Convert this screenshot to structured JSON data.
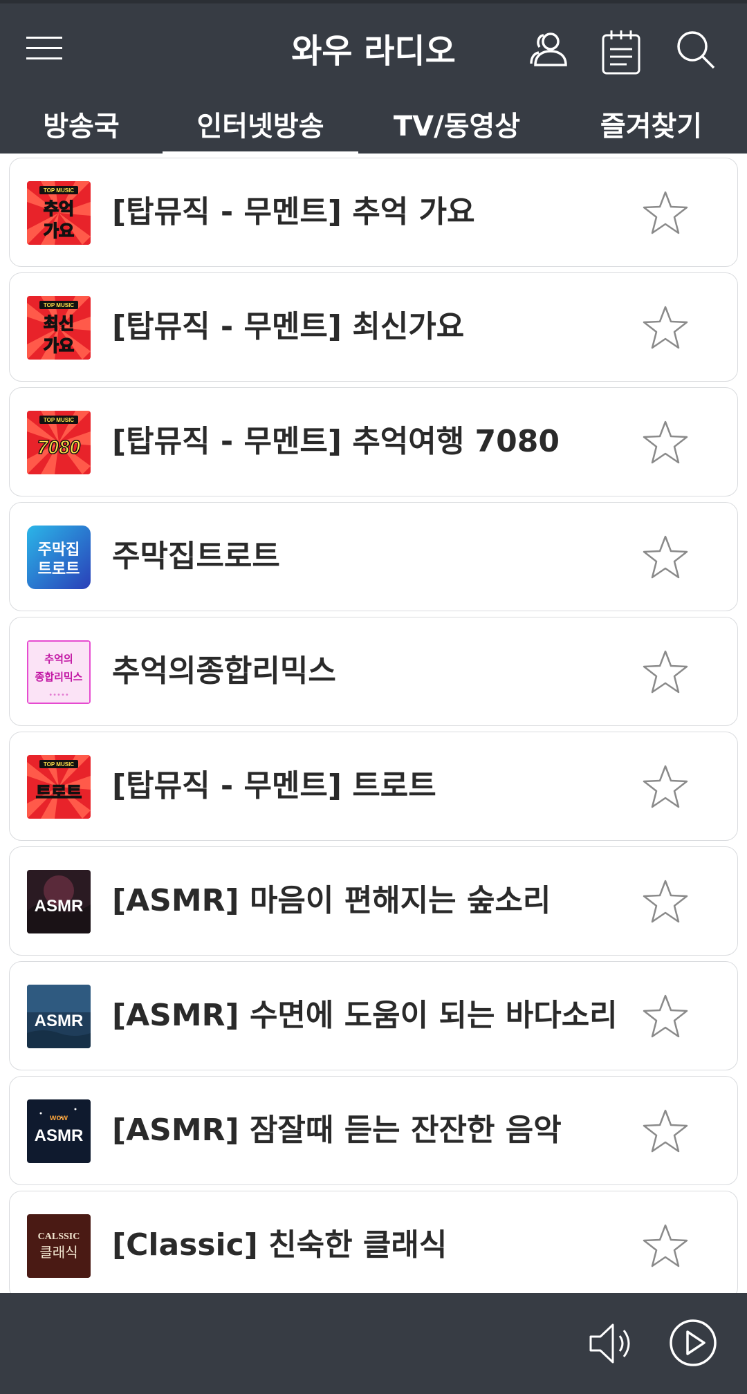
{
  "header": {
    "title": "와우 라디오",
    "menu_icon": "hamburger-menu-icon",
    "user_icon": "user-icon",
    "schedule_icon": "calendar-icon",
    "search_icon": "search-icon"
  },
  "tabs": [
    {
      "label": "방송국",
      "active": false
    },
    {
      "label": "인터넷방송",
      "active": true
    },
    {
      "label": "TV/동영상",
      "active": false
    },
    {
      "label": "즐겨찾기",
      "active": false
    }
  ],
  "stations": [
    {
      "title": "[탑뮤직 - 무멘트] 추억 가요",
      "thumb_badge": "TOP MUSIC",
      "thumb_text": "추억 가요",
      "favorite": false
    },
    {
      "title": "[탑뮤직 - 무멘트] 최신가요",
      "thumb_badge": "TOP MUSIC",
      "thumb_text": "최신 가요",
      "favorite": false
    },
    {
      "title": "[탑뮤직 - 무멘트] 추억여행 7080",
      "thumb_badge": "TOP MUSIC",
      "thumb_text": "7080",
      "favorite": false
    },
    {
      "title": "주막집트로트",
      "thumb_text": "주막집 트로트",
      "favorite": false
    },
    {
      "title": "추억의종합리믹스",
      "thumb_text": "추억의 종합리믹스",
      "favorite": false
    },
    {
      "title": "[탑뮤직 - 무멘트] 트로트",
      "thumb_badge": "TOP MUSIC",
      "thumb_text": "트로트",
      "favorite": false
    },
    {
      "title": "[ASMR] 마음이 편해지는 숲소리",
      "thumb_text": "ASMR",
      "favorite": false
    },
    {
      "title": "[ASMR] 수면에 도움이 되는 바다소리",
      "thumb_text": "ASMR",
      "favorite": false
    },
    {
      "title": "[ASMR] 잠잘때 듣는 잔잔한 음악",
      "thumb_text": "ASMR",
      "favorite": false
    },
    {
      "title": "[Classic] 친숙한 클래식",
      "thumb_text": "CALSSIC 클래식",
      "favorite": false
    }
  ],
  "player": {
    "volume_icon": "speaker-icon",
    "play_icon": "play-icon"
  },
  "colors": {
    "header_bg": "#373c44",
    "card_border": "#d9dbde",
    "star_outline": "#8a8a8a",
    "tab_text": "#ffffff"
  }
}
